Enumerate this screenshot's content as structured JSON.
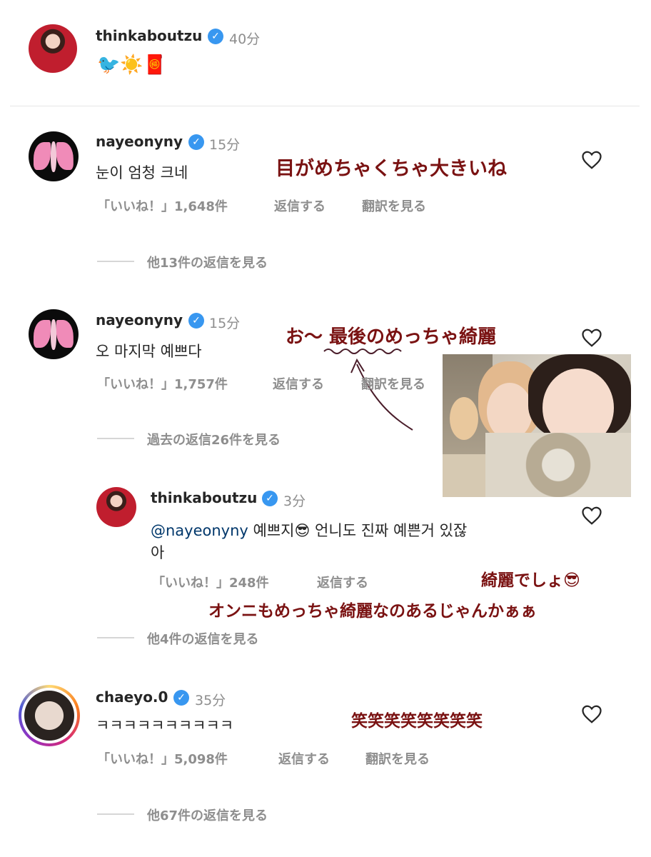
{
  "post": {
    "username": "thinkaboutzu",
    "time": "40分",
    "emojis": "🐦☀️🧧"
  },
  "comments": [
    {
      "username": "nayeonyny",
      "time": "15分",
      "text": "눈이 엄청 크네",
      "likes": "「いいね！」1,648件",
      "reply": "返信する",
      "translate": "翻訳を見る",
      "view_replies": "他13件の返信を見る",
      "annotation": "目がめちゃくちゃ大きいね"
    },
    {
      "username": "nayeonyny",
      "time": "15分",
      "text": "오 마지막 예쁘다",
      "likes": "「いいね！」1,757件",
      "reply": "返信する",
      "translate": "翻訳を見る",
      "view_replies": "過去の返信26件を見る",
      "annotation": "お〜 最後のめっちゃ綺麗"
    },
    {
      "username": "chaeyo.0",
      "time": "35分",
      "text": "ㅋㅋㅋㅋㅋㅋㅋㅋㅋㅋ",
      "likes": "「いいね！」5,098件",
      "reply": "返信する",
      "translate": "翻訳を見る",
      "view_replies": "他67件の返信を見る",
      "annotation": "笑笑笑笑笑笑笑笑"
    }
  ],
  "reply": {
    "username": "thinkaboutzu",
    "time": "3分",
    "mention": "@nayeonyny",
    "text_line1": " 예쁘지😎 언니도 진짜 예쁜거 있잖",
    "text_line2": "아",
    "likes": "「いいね！」248件",
    "reply": "返信する",
    "view_replies": "他4件の返信を見る",
    "annotation1": "綺麗でしょ😎",
    "annotation2": "オンニもめっちゃ綺麗なのあるじゃんかぁぁ"
  },
  "icons": {
    "verified": "verified-badge-icon",
    "heart": "heart-outline-icon"
  },
  "colors": {
    "annotation": "#7a1212",
    "verified": "#3897f0",
    "muted": "#8e8e8e",
    "mention": "#00376b"
  }
}
